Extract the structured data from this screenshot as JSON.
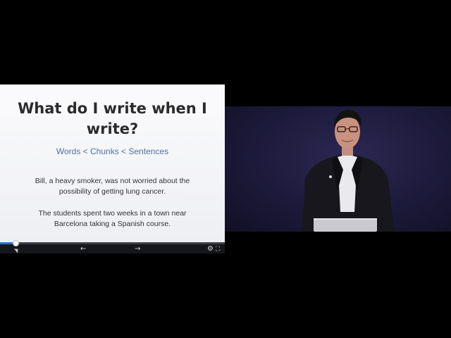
{
  "slide": {
    "title": "What do I write when I write?",
    "subtitle": "Words < Chunks < Sentences",
    "paragraph1": "Bill, a heavy smoker, was not worried about the possibility of getting lung cancer.",
    "paragraph2": "The students spent two weeks in a town near Barcelona taking a Spanish course."
  },
  "player": {
    "prev_icon": "←",
    "next_icon": "→",
    "settings_icon": "⚙",
    "fullscreen_icon": "⛶",
    "progress": 0.07,
    "accent": "#2a6fd6"
  },
  "video": {
    "backdrop_color": "#1c1a3a",
    "laptop_color": "#c9c9cf"
  }
}
